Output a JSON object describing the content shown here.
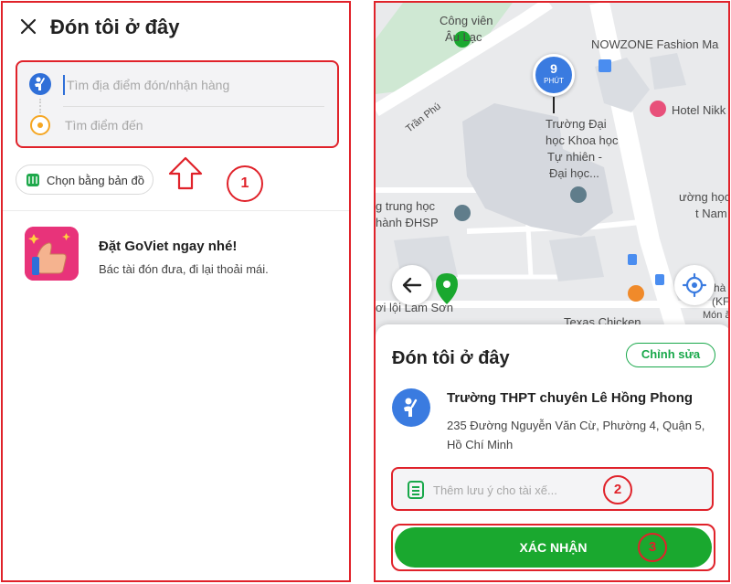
{
  "left": {
    "title": "Đón tôi ở đây",
    "search": {
      "pickup_placeholder": "Tìm địa điểm đón/nhận hàng",
      "destination_placeholder": "Tìm điểm đến"
    },
    "map_chip_label": "Chọn bằng bản đồ",
    "annotation": "1",
    "promo": {
      "title": "Đặt GoViet ngay nhé!",
      "subtitle": "Bác tài đón đưa, đi lại thoải mái."
    }
  },
  "right": {
    "map": {
      "labels": {
        "cong_vien_1": "Công viên",
        "cong_vien_2": "Âu Lạc",
        "nowzone": "NOWZONE Fashion Ma",
        "hotel": "Hotel Nikk",
        "tran_phu": "Trần Phú",
        "truong_dh_1": "Trường Đại",
        "truong_dh_2": "học Khoa học",
        "truong_dh_3": "Tự nhiên -",
        "truong_dh_4": "Đại học...",
        "hoc_thpt_1": "g trung học",
        "hoc_thpt_2": "hành ĐHSP",
        "truong_hoc_right_1": "ường học",
        "truong_hoc_right_2": "t Nam",
        "lam_son": "ơi lội Lam Sơn",
        "texas": "Texas Chicken",
        "ha_kf_1": "hà",
        "ha_kf_2": "(KF",
        "mon_an": "Món ă"
      },
      "eta": {
        "value": "9",
        "unit": "PHÚT"
      }
    },
    "sheet": {
      "title": "Đón tôi ở đây",
      "edit_label": "Chỉnh sửa",
      "place_name": "Trường THPT chuyên Lê Hồng Phong",
      "place_address": "235 Đường Nguyễn Văn Cừ, Phường 4, Quận 5, Hồ Chí Minh",
      "note_placeholder": "Thêm lưu ý cho tài xế...",
      "confirm_label": "XÁC NHẬN",
      "annotation_2": "2",
      "annotation_3": "3"
    }
  },
  "colors": {
    "accent_green": "#1aa82f",
    "primary_blue": "#3a7be0",
    "annotation_red": "#e0222a",
    "destination_orange": "#f5a623"
  }
}
